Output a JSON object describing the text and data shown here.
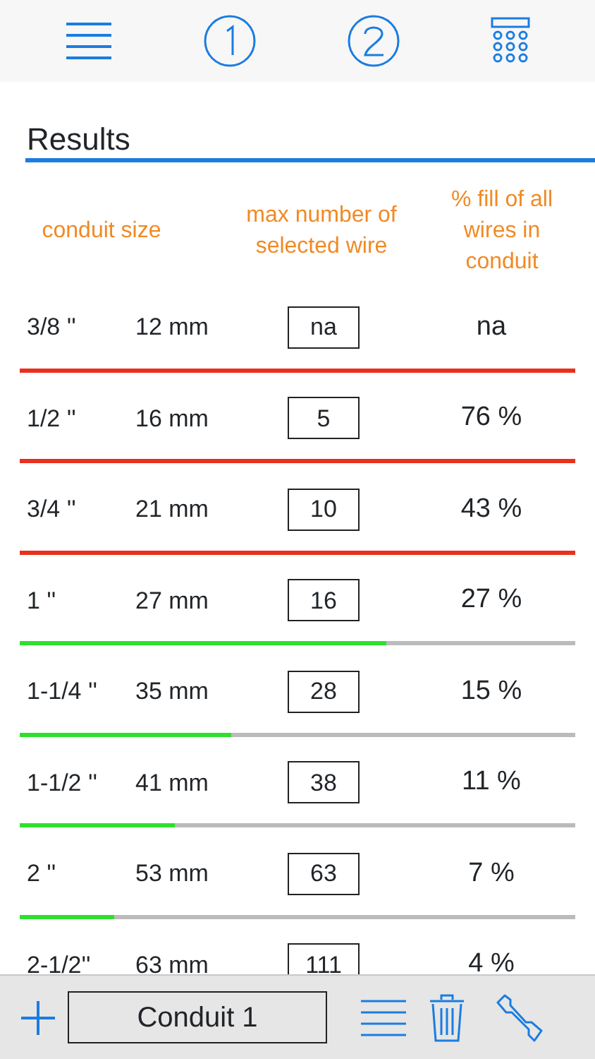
{
  "title": "Results",
  "columns": [
    "conduit size",
    "max number of selected wire",
    "% fill of all wires in conduit"
  ],
  "rows": [
    {
      "inch": "3/8 ''",
      "mm": "12 mm",
      "count": "na",
      "fill": "na",
      "over": true
    },
    {
      "inch": "1/2 ''",
      "mm": "16 mm",
      "count": "5",
      "fill": "76 %",
      "over": true
    },
    {
      "inch": "3/4 ''",
      "mm": "21 mm",
      "count": "10",
      "fill": "43 %",
      "over": true
    },
    {
      "inch": "1 ''",
      "mm": "27 mm",
      "count": "16",
      "fill": "27 %",
      "over": false,
      "level": 0.66
    },
    {
      "inch": "1-1/4 ''",
      "mm": "35 mm",
      "count": "28",
      "fill": "15 %",
      "over": false,
      "level": 0.38
    },
    {
      "inch": "1-1/2 ''",
      "mm": "41 mm",
      "count": "38",
      "fill": "11 %",
      "over": false,
      "level": 0.28
    },
    {
      "inch": "2 ''",
      "mm": "53 mm",
      "count": "63",
      "fill": "7 %",
      "over": false,
      "level": 0.17
    },
    {
      "inch": "2-1/2''",
      "mm": "63 mm",
      "count": "111",
      "fill": "4 %"
    }
  ],
  "bottom_bar": {
    "conduit_name": "Conduit 1"
  }
}
